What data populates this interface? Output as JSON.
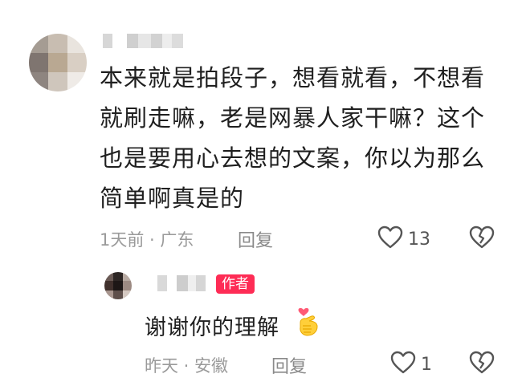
{
  "comment": {
    "text": "本来就是拍段子，想看就看，不想看就刷走嘛，老是网暴人家干嘛？这个也是要用心去想的文案，你以为那么简单啊真是的",
    "meta": "1天前 · 广东",
    "reply_label": "回复",
    "like_count": "13"
  },
  "reply": {
    "author_badge": "作者",
    "text": "谢谢你的理解",
    "meta": "昨天 · 安徽",
    "reply_label": "回复",
    "like_count": "1"
  },
  "icons": {
    "like": "heart-outline-icon",
    "dislike": "broken-heart-icon",
    "emoji": "finger-heart-emoji-icon"
  },
  "colors": {
    "badge": "#fe2c55",
    "meta": "#9a9a9a",
    "text": "#1f1f1f"
  }
}
